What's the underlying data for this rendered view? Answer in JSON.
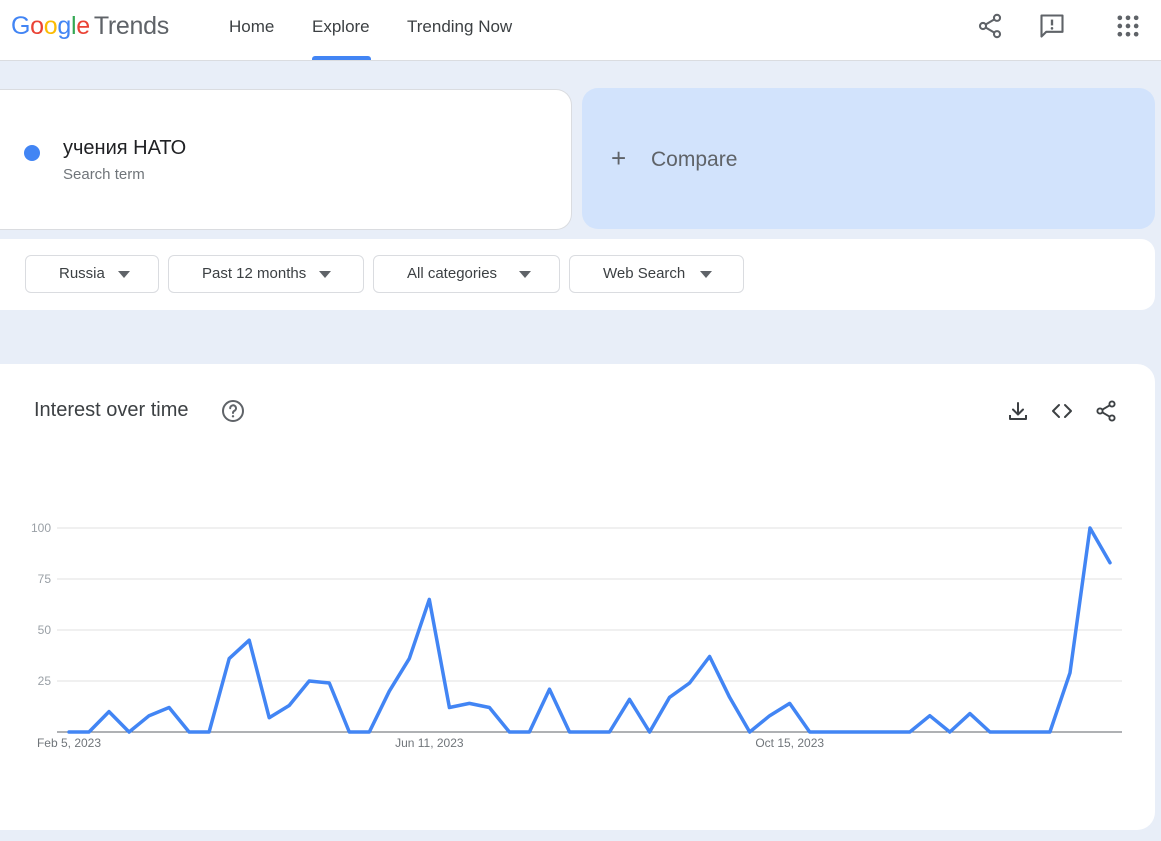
{
  "header": {
    "logo": {
      "G": "G",
      "o1": "o",
      "o2": "o",
      "g": "g",
      "l": "l",
      "e": "e",
      "trends": "Trends"
    },
    "nav": [
      {
        "label": "Home"
      },
      {
        "label": "Explore"
      },
      {
        "label": "Trending Now"
      }
    ],
    "icons": [
      "share-icon",
      "feedback-icon",
      "apps-grid-icon"
    ]
  },
  "search": {
    "term": "учения НАТО",
    "term_sub": "Search term",
    "term_color": "#4285f4",
    "compare_label": "Compare"
  },
  "filters": [
    {
      "label": "Russia"
    },
    {
      "label": "Past 12 months"
    },
    {
      "label": "All categories"
    },
    {
      "label": "Web Search"
    }
  ],
  "chart_section": {
    "title": "Interest over time",
    "icons": [
      "help-icon",
      "download-icon",
      "embed-code-icon",
      "share-icon"
    ]
  },
  "chart_data": {
    "type": "line",
    "title": "Interest over time",
    "x_start": "Feb 5, 2023",
    "x_tick_labels": [
      {
        "label": "Feb 5, 2023",
        "index": 0
      },
      {
        "label": "Jun 11, 2023",
        "index": 18
      },
      {
        "label": "Oct 15, 2023",
        "index": 36
      }
    ],
    "y_ticks": [
      25,
      50,
      75,
      100
    ],
    "ylim": [
      0,
      100
    ],
    "grid": true,
    "series": [
      {
        "color": "#4285f4",
        "values": [
          0,
          0,
          10,
          0,
          8,
          12,
          0,
          0,
          36,
          45,
          7,
          13,
          25,
          24,
          0,
          0,
          20,
          36,
          65,
          12,
          14,
          12,
          0,
          0,
          21,
          0,
          0,
          0,
          16,
          0,
          17,
          24,
          37,
          17,
          0,
          8,
          14,
          0,
          0,
          0,
          0,
          0,
          0,
          8,
          0,
          9,
          0,
          0,
          0,
          0,
          29,
          100,
          83
        ]
      }
    ]
  }
}
